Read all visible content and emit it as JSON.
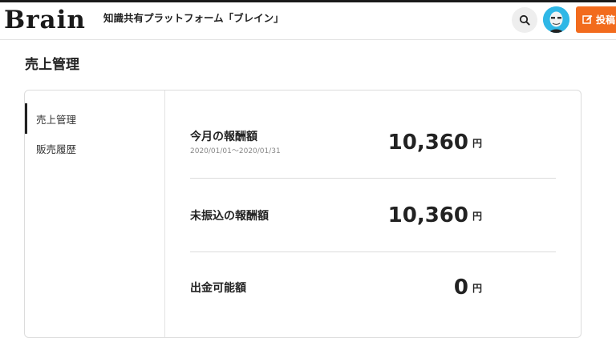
{
  "header": {
    "logo": "Brain",
    "tagline": "知識共有プラットフォーム「ブレイン」",
    "post_label": "投稿"
  },
  "page": {
    "title": "売上管理"
  },
  "sidebar": {
    "items": [
      {
        "label": "売上管理",
        "active": true
      },
      {
        "label": "販売履歴",
        "active": false
      }
    ]
  },
  "summary": {
    "rows": [
      {
        "label": "今月の報酬額",
        "sub": "2020/01/01～2020/01/31",
        "amount": "10,360",
        "unit": "円"
      },
      {
        "label": "未振込の報酬額",
        "amount": "10,360",
        "unit": "円"
      },
      {
        "label": "出金可能額",
        "amount": "0",
        "unit": "円"
      }
    ]
  },
  "icons": {
    "search": "search-icon",
    "avatar": "avatar",
    "post": "edit-icon"
  },
  "colors": {
    "accent": "#f26b1d",
    "avatar_bg": "#2fb7e6",
    "text": "#222222"
  }
}
